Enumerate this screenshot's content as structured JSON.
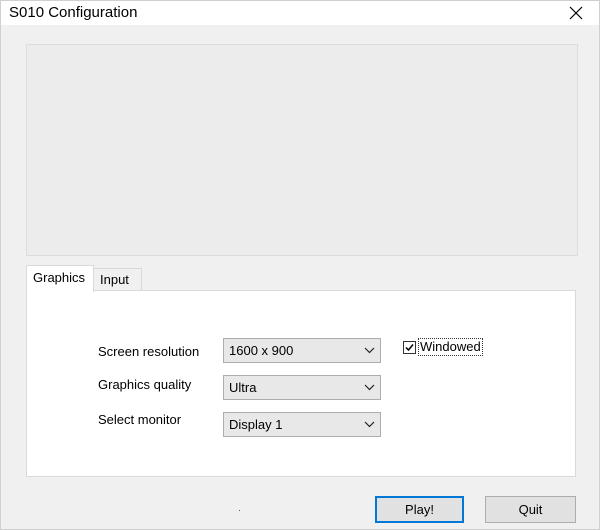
{
  "window": {
    "title": "S010 Configuration"
  },
  "tabs": [
    {
      "label": "Graphics",
      "selected": true
    },
    {
      "label": "Input",
      "selected": false
    }
  ],
  "graphics": {
    "screen_resolution_label": "Screen resolution",
    "screen_resolution_value": "1600 x 900",
    "graphics_quality_label": "Graphics quality",
    "graphics_quality_value": "Ultra",
    "select_monitor_label": "Select monitor",
    "select_monitor_value": "Display 1",
    "windowed_label": "Windowed",
    "windowed_checked": true
  },
  "buttons": {
    "play_label": "Play!",
    "quit_label": "Quit"
  },
  "icons": {
    "close": "close-icon",
    "dropdown": "chevron-down-icon",
    "check": "check-icon"
  },
  "colors": {
    "focus_border": "#0078d7",
    "button_bg": "#e1e1e1",
    "panel_bg": "#ffffff"
  }
}
